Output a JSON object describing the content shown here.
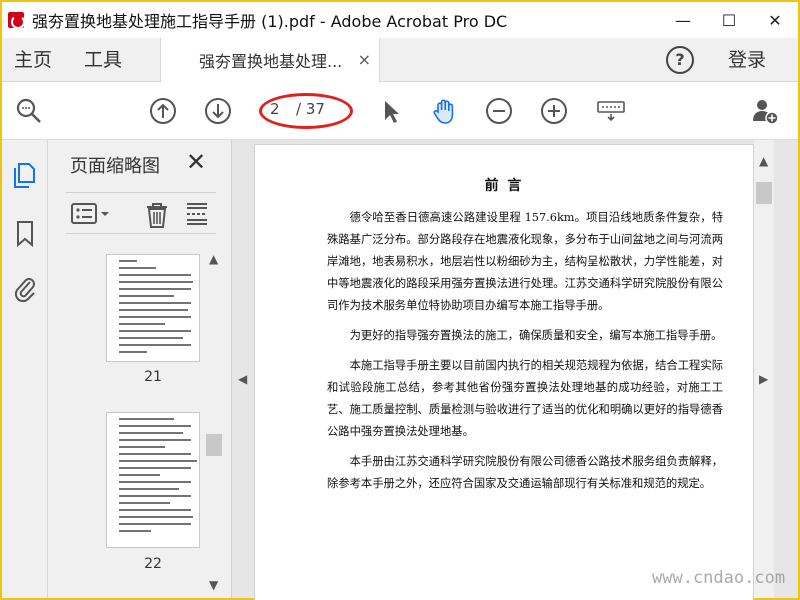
{
  "window": {
    "title": "强夯置换地基处理施工指导手册 (1).pdf - Adobe Acrobat Pro DC",
    "controls": {
      "minimize": "—",
      "maximize": "☐",
      "close": "✕"
    }
  },
  "tabs": {
    "home": "主页",
    "tools": "工具",
    "document": "强夯置换地基处理...",
    "close": "×",
    "help": "?",
    "login": "登录"
  },
  "toolbar": {
    "current_page": "2",
    "total_pages": "/ 37"
  },
  "panel": {
    "title": "页面缩略图",
    "close": "✕",
    "thumbnails": [
      {
        "label": "21"
      },
      {
        "label": "22"
      }
    ]
  },
  "document": {
    "heading": "前    言",
    "paragraphs": [
      "德令哈至香日德高速公路建设里程 157.6km。项目沿线地质条件复杂，特殊路基广泛分布。部分路段存在地震液化现象，多分布于山间盆地之间与河流两岸滩地，地表易积水，地层岩性以粉细砂为主，结构呈松散状，力学性能差，对中等地震液化的路段采用强夯置换法进行处理。江苏交通科学研究院股份有限公司作为技术服务单位特协助项目办编写本施工指导手册。",
      "为更好的指导强夯置换法的施工，确保质量和安全，编写本施工指导手册。",
      "本施工指导手册主要以目前国内执行的相关规范规程为依据，结合工程实际和试验段施工总结，参考其他省份强夯置换法处理地基的成功经验，对施工工艺、施工质量控制、质量检测与验收进行了适当的优化和明确以更好的指导德香公路中强夯置换法处理地基。",
      "本手册由江苏交通科学研究院股份有限公司德香公路技术服务组负责解释，除参考本手册之外，还应符合国家及交通运输部现行有关标准和规范的规定。"
    ]
  },
  "watermark": "www.cndao.com",
  "colors": {
    "accent": "#1473e6",
    "annotation": "#e1201a",
    "frame": "#f1c40f"
  }
}
